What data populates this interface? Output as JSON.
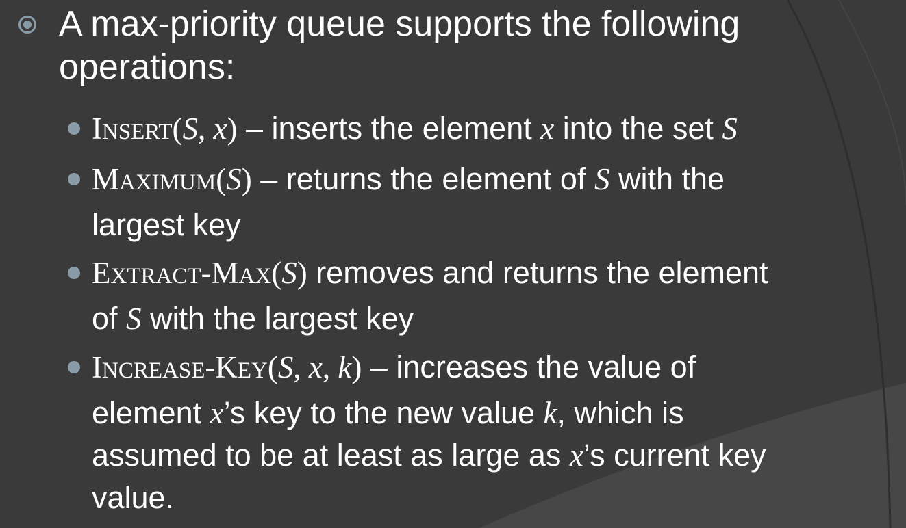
{
  "slide": {
    "heading": {
      "line1": "A max-priority queue supports the following",
      "line2": "operations:"
    },
    "items": [
      {
        "op_first": "I",
        "op_rest": "NSERT",
        "args_open": "(",
        "arg1": "S",
        "sep1": ", ",
        "arg2": "x",
        "args_close": ")",
        "desc_a": " – inserts the element ",
        "desc_var1": "x",
        "desc_b": " into the set ",
        "desc_var2": "S"
      },
      {
        "op_first": "M",
        "op_rest": "AXIMUM",
        "args_open": "(",
        "arg1": "S",
        "args_close": ")",
        "desc_a": " – returns the element of ",
        "desc_var1": "S",
        "desc_b": " with the",
        "desc_line2": "largest key"
      },
      {
        "op_first1": "E",
        "op_rest1": "XTRACT",
        "op_dash": "-",
        "op_first2": "M",
        "op_rest2": "AX",
        "args_open": "(",
        "arg1": "S",
        "args_close": ")",
        "desc_a": " removes and returns the element",
        "desc_line2_a": "of ",
        "desc_var1": "S",
        "desc_line2_b": " with the largest key"
      },
      {
        "op_first1": "I",
        "op_rest1": "NCREASE",
        "op_dash": "-",
        "op_first2": "K",
        "op_rest2": "EY",
        "args_open": "(",
        "arg1": "S",
        "sep1": ", ",
        "arg2": "x",
        "sep2": ", ",
        "arg3": "k",
        "args_close": ")",
        "desc_a": " – increases the value of",
        "line2_a": "element ",
        "line2_var": "x",
        "line2_b": "’s key to the new value ",
        "line2_var2": "k",
        "line2_c": ", which is",
        "line3_a": "assumed to be at least as large as ",
        "line3_var": "x",
        "line3_b": "’s current key",
        "line4": "value."
      }
    ]
  },
  "colors": {
    "background": "#3a3a3a",
    "text": "#ffffff",
    "bullet": "#8a9ba8"
  }
}
